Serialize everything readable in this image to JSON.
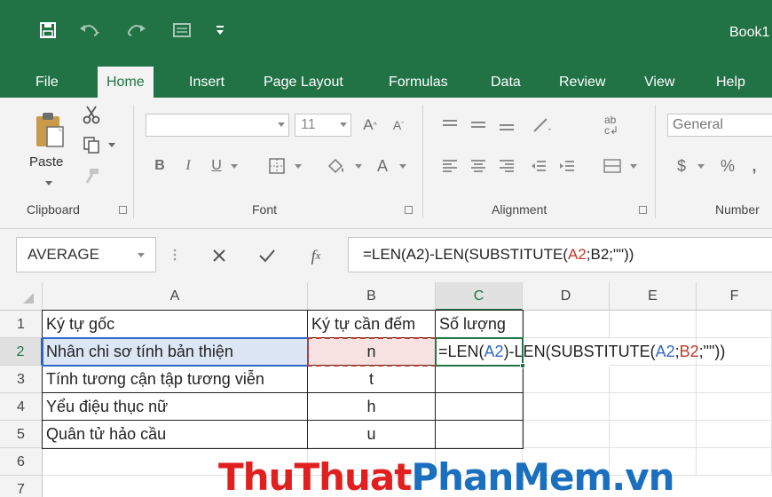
{
  "window": {
    "title": "Book1"
  },
  "ribbon_tabs": [
    "File",
    "Home",
    "Insert",
    "Page Layout",
    "Formulas",
    "Data",
    "Review",
    "View",
    "Help"
  ],
  "clipboard": {
    "paste_label": "Paste",
    "group_label": "Clipboard"
  },
  "font": {
    "size": "11",
    "group_label": "Font"
  },
  "alignment": {
    "group_label": "Alignment"
  },
  "number": {
    "format": "General",
    "currency_symbol": "$",
    "percent_symbol": "%",
    "comma_symbol": ",",
    "group_label": "Number"
  },
  "name_box": "AVERAGE",
  "formula_bar": {
    "formula": "=LEN(A2)-LEN(SUBSTITUTE(A2;B2;\"\"))",
    "parts": [
      "=LEN(A2)-LEN(SUBSTITUTE(",
      "A2",
      ";",
      "B2",
      ";\"\"))"
    ]
  },
  "grid": {
    "columns": [
      "A",
      "B",
      "C",
      "D",
      "E",
      "F"
    ],
    "row_numbers": [
      "1",
      "2",
      "3",
      "4",
      "5",
      "6",
      "7"
    ],
    "header_row": [
      "Ký tự gốc",
      "Ký tự cần đếm",
      "Số lượng"
    ],
    "rows": [
      {
        "a": "Nhân chi sơ tính bản thiện",
        "b": "n"
      },
      {
        "a": "Tính tương cận tập tương viễn",
        "b": "t"
      },
      {
        "a": "Yểu điệu thục nữ",
        "b": "h"
      },
      {
        "a": "Quân tử hảo cầu",
        "b": "u"
      }
    ],
    "editing_cell_parts": [
      "=LEN(",
      "A2",
      ")-LEN(SUBSTITUTE(",
      "A2",
      ";",
      "B2",
      ";\"\"))"
    ]
  },
  "watermark": {
    "part1": "ThuThuat",
    "part2": "PhanMem",
    "part3": ".vn"
  },
  "colors": {
    "excel_green": "#217346",
    "ref_blue": "#3366cc",
    "ref_red": "#c0392b",
    "watermark_red": "#e02020",
    "watermark_blue": "#1a6fbf"
  }
}
